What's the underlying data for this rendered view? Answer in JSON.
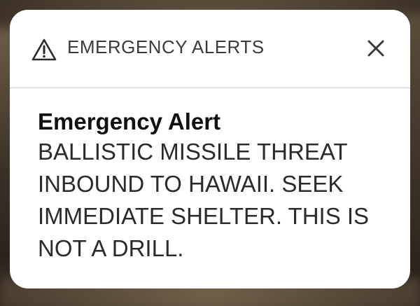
{
  "header": {
    "title": "EMERGENCY ALERTS",
    "icon": "warning-triangle-icon",
    "close_icon": "close-icon"
  },
  "alert": {
    "title": "Emergency Alert",
    "message": "BALLISTIC MISSILE THREAT INBOUND TO HAWAII. SEEK IMMEDIATE SHELTER. THIS IS NOT A DRILL."
  },
  "colors": {
    "card_background": "#ffffff",
    "header_text": "#3b3b3b",
    "title_text": "#111111",
    "message_text": "#2b2b2b",
    "divider": "#cfcfcf"
  }
}
